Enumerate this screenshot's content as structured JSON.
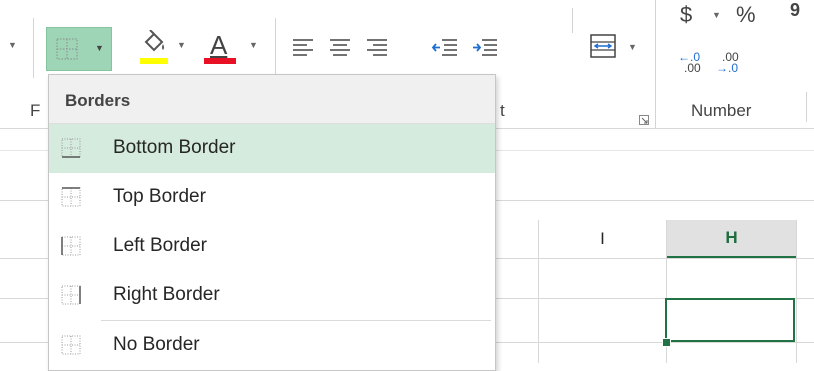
{
  "ribbon": {
    "font_group_label_partial": "F",
    "alignment_group_label_partial": "t",
    "number_group_label": "Number",
    "currency_symbol": "$",
    "percent_symbol": "%",
    "comma_symbol": "9",
    "increase_decimal_top": "←.0",
    "increase_decimal_bottom": ".00",
    "decrease_decimal_top": ".00",
    "decrease_decimal_bottom": "→.0",
    "borders_button_state": "active",
    "fill_color": "#ffff00",
    "font_color": "#e81123"
  },
  "sheet": {
    "column_I_header": "I",
    "column_H_header": "H",
    "selected_cell_color": "#217346"
  },
  "menu": {
    "header": "Borders",
    "items": [
      {
        "label": "Bottom Border",
        "highlighted": true
      },
      {
        "label": "Top Border",
        "highlighted": false
      },
      {
        "label": "Left Border",
        "highlighted": false
      },
      {
        "label": "Right Border",
        "highlighted": false
      },
      {
        "label": "No Border",
        "highlighted": false
      }
    ]
  },
  "colors": {
    "accent": "#217346",
    "highlight": "#d5ebde",
    "active_button": "#9fd5b7"
  }
}
